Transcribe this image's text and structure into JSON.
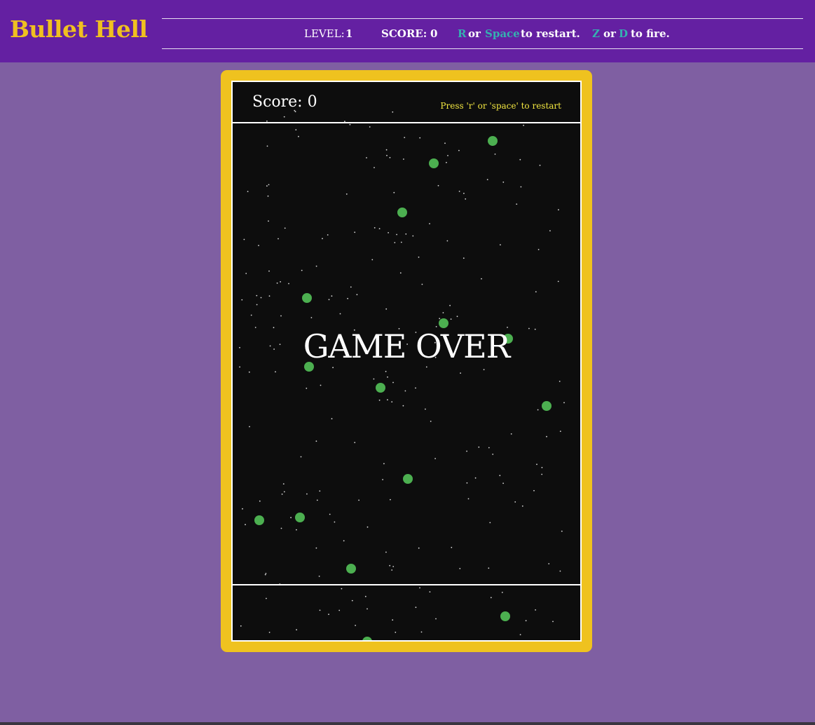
{
  "header": {
    "title": "Bullet Hell",
    "level_label": "LEVEL:",
    "level_value": "1",
    "score_label": "SCORE:",
    "score_value": "0",
    "restart_key1": "R",
    "or1": "or",
    "restart_key2": "Space",
    "restart_text": "to restart.",
    "fire_key1": "Z",
    "or2": "or",
    "fire_key2": "D",
    "fire_text": "to fire."
  },
  "game": {
    "score_label": "Score:",
    "score_value": "0",
    "restart_hint": "Press 'r' or 'space' to restart",
    "status_text": "GAME OVER"
  },
  "colors": {
    "page_bg": "#7f5fa2",
    "header_bg": "#6420a2",
    "brand": "#f0c020",
    "key_accent": "#35b0b0",
    "frame": "#efc21f",
    "screen_bg": "#0d0d0d",
    "enemy": "#4caf50",
    "restart_hint": "#f2e640"
  },
  "entities": {
    "enemy_count": 18,
    "enemy_shape": "green-circle"
  }
}
